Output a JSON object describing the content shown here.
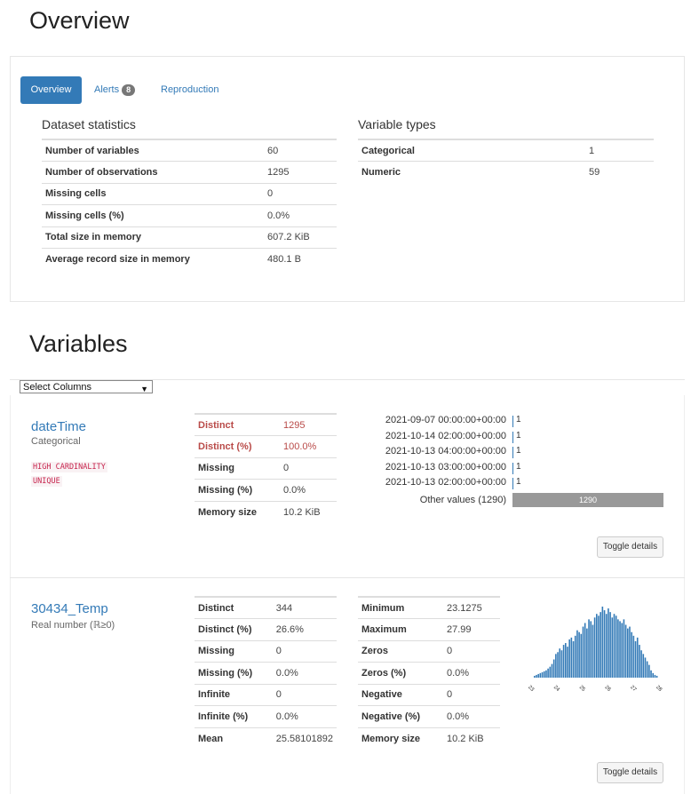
{
  "overview": {
    "title": "Overview",
    "tabs": [
      {
        "label": "Overview",
        "active": true
      },
      {
        "label": "Alerts",
        "badge": "8"
      },
      {
        "label": "Reproduction"
      }
    ],
    "dataset_statistics": {
      "heading": "Dataset statistics",
      "rows": [
        {
          "k": "Number of variables",
          "v": "60"
        },
        {
          "k": "Number of observations",
          "v": "1295"
        },
        {
          "k": "Missing cells",
          "v": "0"
        },
        {
          "k": "Missing cells (%)",
          "v": "0.0%"
        },
        {
          "k": "Total size in memory",
          "v": "607.2 KiB"
        },
        {
          "k": "Average record size in memory",
          "v": "480.1 B"
        }
      ]
    },
    "variable_types": {
      "heading": "Variable types",
      "rows": [
        {
          "k": "Categorical",
          "v": "1"
        },
        {
          "k": "Numeric",
          "v": "59"
        }
      ]
    }
  },
  "variables": {
    "title": "Variables",
    "select_label": "Select Columns",
    "items": [
      {
        "name": "dateTime",
        "type": "Categorical",
        "tags": [
          "HIGH CARDINALITY",
          "UNIQUE"
        ],
        "stats": [
          {
            "k": "Distinct",
            "v": "1295",
            "alert": true
          },
          {
            "k": "Distinct (%)",
            "v": "100.0%",
            "alert": true
          },
          {
            "k": "Missing",
            "v": "0"
          },
          {
            "k": "Missing (%)",
            "v": "0.0%"
          },
          {
            "k": "Memory size",
            "v": "10.2 KiB"
          }
        ],
        "frequencies": [
          {
            "label": "2021-09-07 00:00:00+00:00",
            "count": "1"
          },
          {
            "label": "2021-10-14 02:00:00+00:00",
            "count": "1"
          },
          {
            "label": "2021-10-13 04:00:00+00:00",
            "count": "1"
          },
          {
            "label": "2021-10-13 03:00:00+00:00",
            "count": "1"
          },
          {
            "label": "2021-10-13 02:00:00+00:00",
            "count": "1"
          }
        ],
        "other_label": "Other values (1290)",
        "other_count": "1290",
        "toggle_label": "Toggle details"
      },
      {
        "name": "30434_Temp",
        "type": "Real number (ℝ≥0)",
        "stats_left": [
          {
            "k": "Distinct",
            "v": "344"
          },
          {
            "k": "Distinct (%)",
            "v": "26.6%"
          },
          {
            "k": "Missing",
            "v": "0"
          },
          {
            "k": "Missing (%)",
            "v": "0.0%"
          },
          {
            "k": "Infinite",
            "v": "0"
          },
          {
            "k": "Infinite (%)",
            "v": "0.0%"
          },
          {
            "k": "Mean",
            "v": "25.58101892"
          }
        ],
        "stats_right": [
          {
            "k": "Minimum",
            "v": "23.1275"
          },
          {
            "k": "Maximum",
            "v": "27.99"
          },
          {
            "k": "Zeros",
            "v": "0"
          },
          {
            "k": "Zeros (%)",
            "v": "0.0%"
          },
          {
            "k": "Negative",
            "v": "0"
          },
          {
            "k": "Negative (%)",
            "v": "0.0%"
          },
          {
            "k": "Memory size",
            "v": "10.2 KiB"
          }
        ],
        "toggle_label": "Toggle details"
      }
    ]
  },
  "colors": {
    "accent": "#337ab7",
    "alert": "#b94a48",
    "other_bar": "#999999"
  },
  "chart_data": {
    "type": "bar",
    "x_tick_labels": [
      "23",
      "24",
      "25",
      "26",
      "27",
      "28"
    ],
    "xlim": [
      23.1275,
      27.99
    ],
    "values": [
      2,
      3,
      4,
      5,
      6,
      7,
      8,
      10,
      12,
      15,
      20,
      26,
      28,
      32,
      30,
      36,
      38,
      34,
      42,
      44,
      40,
      46,
      52,
      50,
      48,
      56,
      60,
      54,
      64,
      62,
      58,
      66,
      70,
      68,
      72,
      78,
      74,
      70,
      76,
      72,
      66,
      70,
      68,
      64,
      62,
      60,
      64,
      58,
      54,
      56,
      50,
      46,
      40,
      44,
      36,
      30,
      26,
      22,
      18,
      14,
      8,
      5,
      3,
      2
    ]
  }
}
